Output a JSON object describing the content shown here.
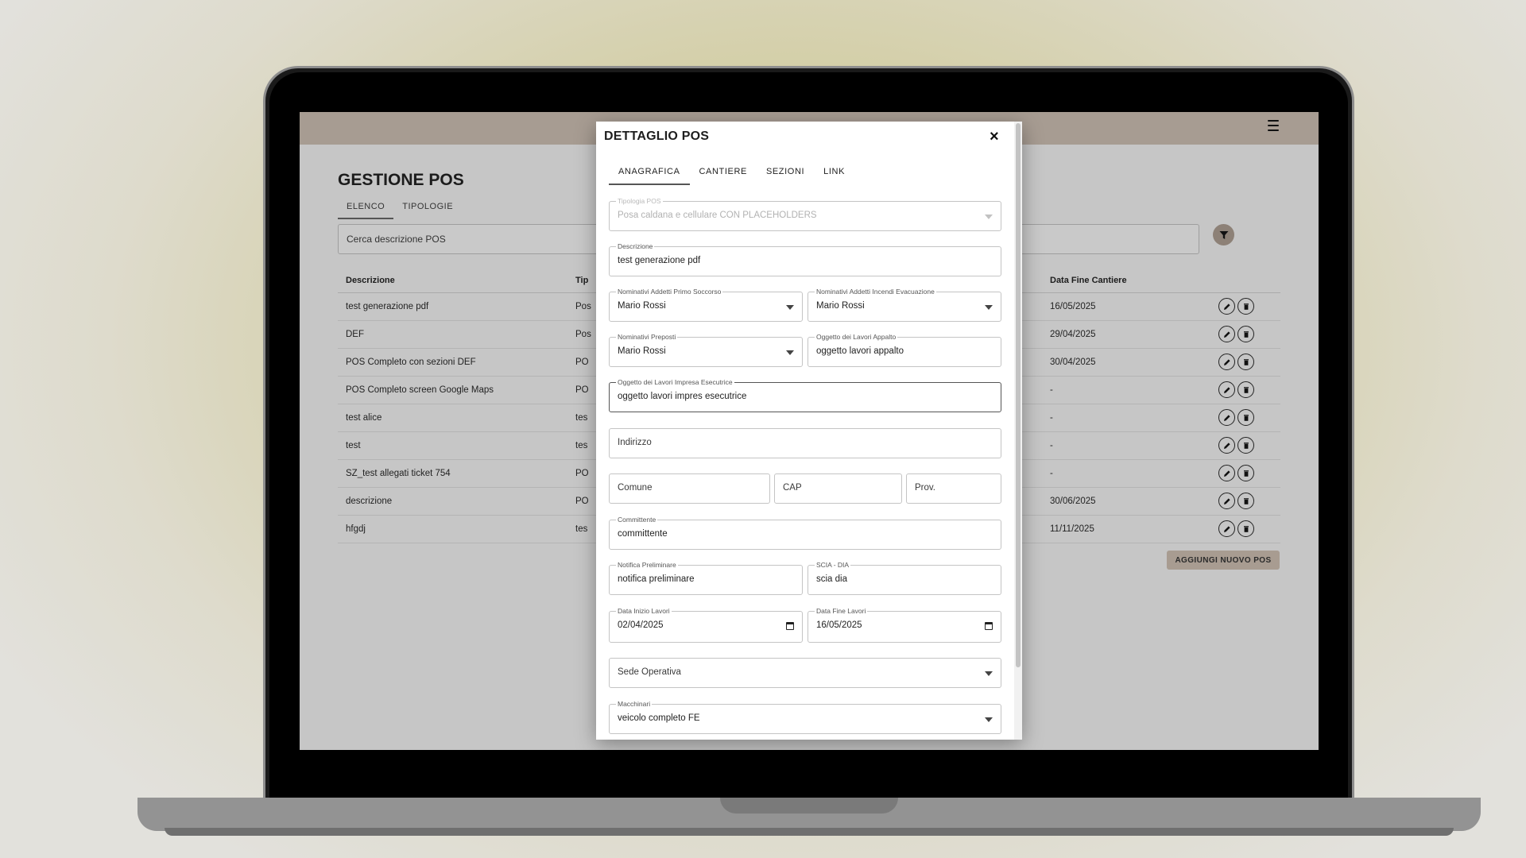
{
  "app": {
    "title": "GESTIONE POS",
    "tabs": [
      {
        "label": "ELENCO",
        "active": true
      },
      {
        "label": "TIPOLOGIE",
        "active": false
      }
    ],
    "search_placeholder": "Cerca descrizione POS",
    "add_button": "AGGIUNGI NUOVO POS",
    "table": {
      "headers": [
        "Descrizione",
        "Tip",
        "Data Fine Cantiere"
      ],
      "rows": [
        {
          "descrizione": "test generazione pdf",
          "tipo": "Pos",
          "data_fine": "16/05/2025"
        },
        {
          "descrizione": "DEF",
          "tipo": "Pos",
          "data_fine": "29/04/2025"
        },
        {
          "descrizione": "POS Completo con sezioni DEF",
          "tipo": "PO",
          "data_fine": "30/04/2025"
        },
        {
          "descrizione": "POS Completo screen Google Maps",
          "tipo": "PO",
          "data_fine": "-"
        },
        {
          "descrizione": "test alice",
          "tipo": "tes",
          "data_fine": "-"
        },
        {
          "descrizione": "test",
          "tipo": "tes",
          "data_fine": "-"
        },
        {
          "descrizione": "SZ_test allegati ticket 754",
          "tipo": "PO",
          "data_fine": "-"
        },
        {
          "descrizione": "descrizione",
          "tipo": "PO",
          "data_fine": "30/06/2025"
        },
        {
          "descrizione": "hfgdj",
          "tipo": "tes",
          "data_fine": "11/11/2025"
        }
      ]
    }
  },
  "modal": {
    "title": "DETTAGLIO POS",
    "close_icon": "×",
    "tabs": [
      {
        "label": "ANAGRAFICA",
        "active": true
      },
      {
        "label": "CANTIERE",
        "active": false
      },
      {
        "label": "SEZIONI",
        "active": false
      },
      {
        "label": "LINK",
        "active": false
      }
    ],
    "fields": {
      "tipologia": {
        "label": "Tipologia POS",
        "value": "Posa caldana e cellulare CON PLACEHOLDERS"
      },
      "descrizione": {
        "label": "Descrizione",
        "value": "test generazione pdf"
      },
      "primo_soccorso": {
        "label": "Nominativi Addetti Primo Soccorso",
        "value": "Mario Rossi"
      },
      "incendi": {
        "label": "Nominativi Addetti Incendi Evacuazione",
        "value": "Mario Rossi"
      },
      "preposti": {
        "label": "Nominativi Preposti",
        "value": "Mario Rossi"
      },
      "oggetto_appalto": {
        "label": "Oggetto dei Lavori Appalto",
        "value": "oggetto lavori appalto"
      },
      "oggetto_impresa": {
        "label": "Oggetto dei Lavori Impresa Esecutrice",
        "value": "oggetto lavori impres esecutrice"
      },
      "indirizzo": {
        "placeholder": "Indirizzo"
      },
      "comune": {
        "placeholder": "Comune"
      },
      "cap": {
        "placeholder": "CAP"
      },
      "prov": {
        "placeholder": "Prov."
      },
      "committente": {
        "label": "Committente",
        "value": "committente"
      },
      "notifica": {
        "label": "Notifica Preliminare",
        "value": "notifica preliminare"
      },
      "scia": {
        "label": "SCIA - DIA",
        "value": "scia dia"
      },
      "data_inizio": {
        "label": "Data Inizio Lavori",
        "value": "02/04/2025"
      },
      "data_fine": {
        "label": "Data Fine Lavori",
        "value": "16/05/2025"
      },
      "sede": {
        "placeholder": "Sede Operativa"
      },
      "macchinari": {
        "label": "Macchinari",
        "value": "veicolo completo FE"
      }
    }
  },
  "colors": {
    "appbar": "#a79c92",
    "accent_button": "#a89c91",
    "overlay_screen": "#c6c6c6"
  },
  "icons": {
    "menu": "hamburger-icon",
    "filter": "filter-icon",
    "edit": "pencil-icon",
    "delete": "trash-icon",
    "close": "close-icon",
    "dropdown": "caret-down-icon",
    "calendar": "calendar-icon"
  }
}
